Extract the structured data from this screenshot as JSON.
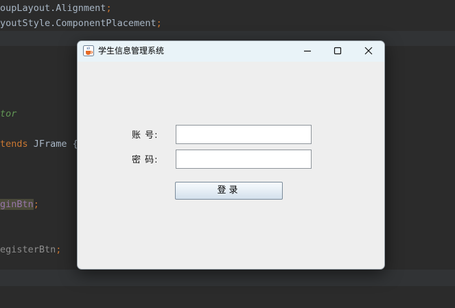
{
  "editor": {
    "lines": [
      {
        "pre": "oupLayout.Alignment",
        "post": ";"
      },
      {
        "pre": "youtStyle.ComponentPlacement",
        "post": ";"
      },
      {
        "text": "tor"
      },
      {
        "kw": "tends",
        "rest": " JFrame {"
      },
      {
        "field": "ginBtn",
        "post": ";"
      },
      {
        "field": "egisterBtn",
        "post": ";"
      }
    ]
  },
  "dialog": {
    "title": "学生信息管理系统",
    "icon": "java-cup-icon",
    "controls": {
      "minimize": "minimize-icon",
      "maximize": "maximize-icon",
      "close": "close-icon"
    },
    "account_label": "账 号:",
    "account_value": "",
    "password_label": "密 码:",
    "password_value": "",
    "login_label": "登录"
  },
  "colors": {
    "editor_bg": "#2b2b2b",
    "dialog_bg": "#eeeeee",
    "titlebar_bg": "#e9f3f8",
    "code_text": "#a9b7c6",
    "keyword": "#cc7832"
  }
}
